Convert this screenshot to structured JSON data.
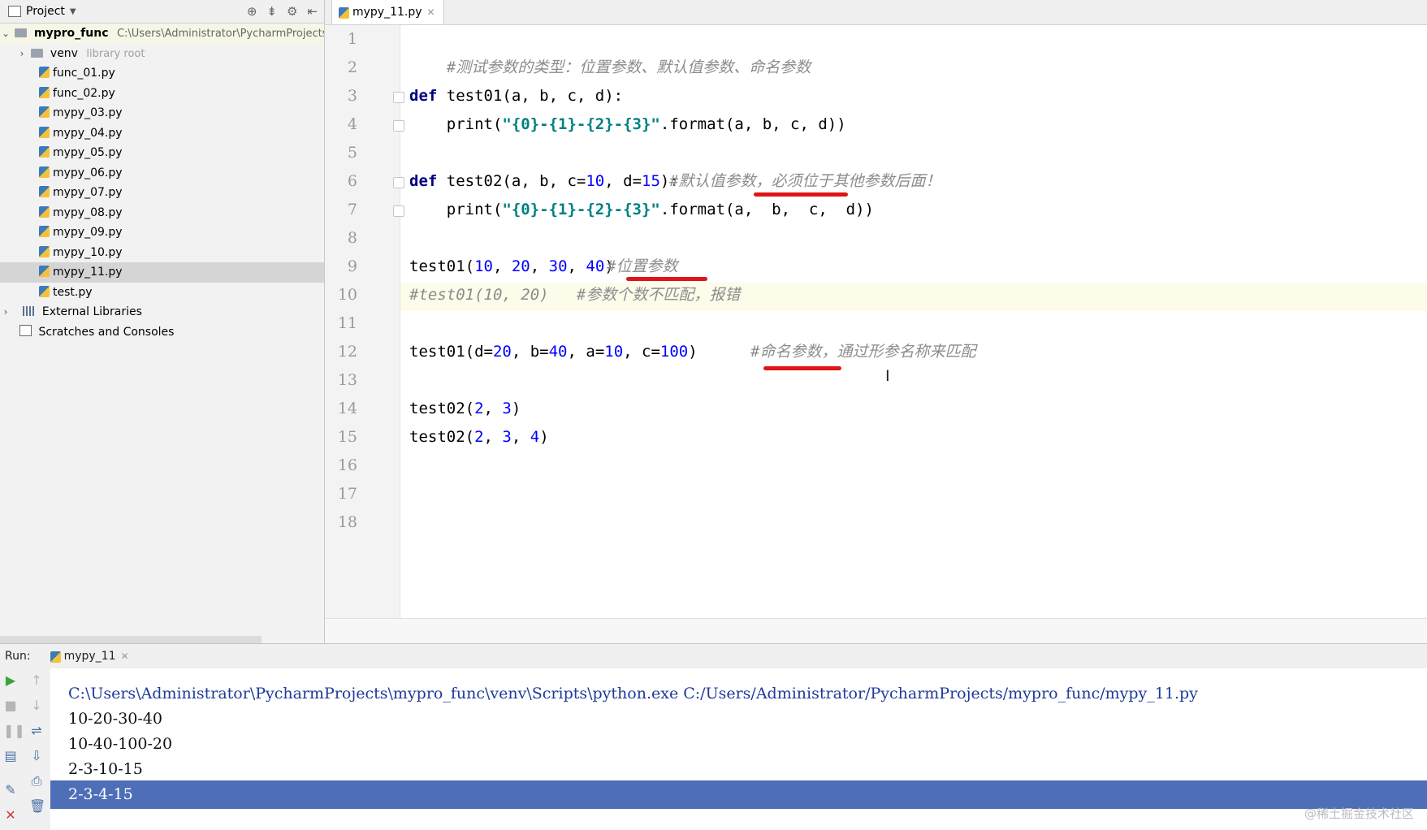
{
  "project_panel": {
    "title": "Project",
    "tree": [
      {
        "label": "mypro_func",
        "path": "C:\\Users\\Administrator\\PycharmProjects"
      },
      {
        "label": "venv",
        "hint": "library root"
      },
      {
        "label": "func_01.py"
      },
      {
        "label": "func_02.py"
      },
      {
        "label": "mypy_03.py"
      },
      {
        "label": "mypy_04.py"
      },
      {
        "label": "mypy_05.py"
      },
      {
        "label": "mypy_06.py"
      },
      {
        "label": "mypy_07.py"
      },
      {
        "label": "mypy_08.py"
      },
      {
        "label": "mypy_09.py"
      },
      {
        "label": "mypy_10.py"
      },
      {
        "label": "mypy_11.py",
        "selected": true
      },
      {
        "label": "test.py"
      },
      {
        "label": "External Libraries"
      },
      {
        "label": "Scratches and Consoles"
      }
    ]
  },
  "editor": {
    "tab_label": "mypy_11.py",
    "line_numbers": [
      "1",
      "2",
      "3",
      "4",
      "5",
      "6",
      "7",
      "8",
      "9",
      "10",
      "11",
      "12",
      "13",
      "14",
      "15",
      "16",
      "17",
      "18"
    ],
    "code": {
      "l1_comment": "#测试参数的类型：位置参数、默认值参数、命名参数",
      "l3_kw": "def",
      "l3_rest": " test01(a, b, c, d):",
      "l4_indent": "    ",
      "l4_fn": "print(",
      "l4_str": "\"{0}-{1}-{2}-{3}\"",
      "l4_rest": ".format(a, b, c, d))",
      "l6_kw": "def",
      "l6_a": " test02(a, b, c=",
      "l6_n1": "10",
      "l6_b": ", d=",
      "l6_n2": "15",
      "l6_c": "):",
      "l6_comment": "#默认值参数，必须位于其他参数后面！",
      "l7_indent": "    ",
      "l7_fn": "print(",
      "l7_str": "\"{0}-{1}-{2}-{3}\"",
      "l7_rest": ".format(a,  b,  c,  d))",
      "l9_a": "test01(",
      "l9_n1": "10",
      "l9_n2": "20",
      "l9_n3": "30",
      "l9_n4": "40",
      "l9_close": ")",
      "l9_comment": "#位置参数",
      "l10_comment": "#test01(10, 20)   #参数个数不匹配，报错",
      "l12_a": "test01(d=",
      "l12_n1": "20",
      "l12_b": ", b=",
      "l12_n2": "40",
      "l12_c": ", a=",
      "l12_n3": "10",
      "l12_d": ", c=",
      "l12_n4": "100",
      "l12_close": ")",
      "l12_comment": "#命名参数，通过形参名称来匹配",
      "l14_a": "test02(",
      "l14_n1": "2",
      "l14_n2": "3",
      "l14_close": ")",
      "l15_a": "test02(",
      "l15_n1": "2",
      "l15_n2": "3",
      "l15_n3": "4",
      "l15_close": ")"
    }
  },
  "run_panel": {
    "label": "Run:",
    "tab_label": "mypy_11",
    "output": [
      "C:\\Users\\Administrator\\PycharmProjects\\mypro_func\\venv\\Scripts\\python.exe C:/Users/Administrator/PycharmProjects/mypro_func/mypy_11.py",
      "10-20-30-40",
      "10-40-100-20",
      "2-3-10-15",
      "2-3-4-15"
    ]
  },
  "watermark": "@稀土掘金技术社区",
  "colors": {
    "keyword": "#000080",
    "number": "#0000ff",
    "string": "#008080",
    "comment": "#8c8c8c",
    "annotation_underline": "#e01515",
    "console_selection": "#4e6eb8"
  }
}
